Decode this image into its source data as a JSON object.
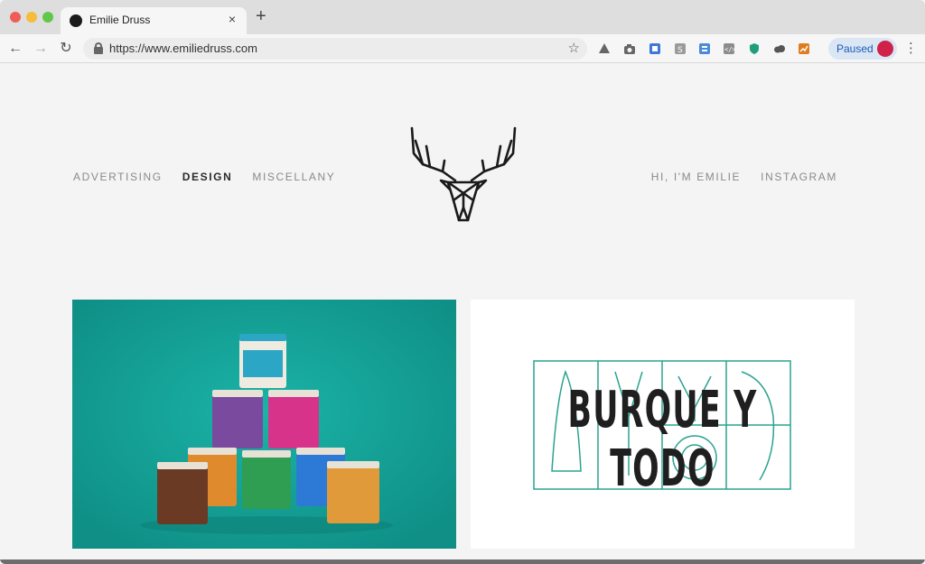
{
  "browser": {
    "tab_title": "Emilie Druss",
    "url": "https://www.emiliedruss.com",
    "profile_status": "Paused",
    "new_tab_label": "+",
    "close_label": "×",
    "menu_label": "⋮",
    "icons": {
      "back": "←",
      "forward": "→",
      "reload": "↻",
      "star": "☆"
    },
    "extensions": [
      "drive-icon",
      "camera-icon",
      "extension-blue-icon",
      "extension-grey-icon",
      "extension-doc-icon",
      "code-icon",
      "shield-icon",
      "cloud-icon",
      "chart-icon"
    ]
  },
  "site": {
    "nav_left": [
      "ADVERTISING",
      "DESIGN",
      "MISCELLANY"
    ],
    "nav_active": "DESIGN",
    "nav_right": [
      "HI, I'M EMILIE",
      "INSTAGRAM"
    ],
    "projects": [
      {
        "name": "ice-cream-packaging",
        "tile_color": "#16a197"
      },
      {
        "name": "burque-y-todo",
        "title": "BURQUE Y TODO",
        "accent": "#2aa38f"
      }
    ]
  },
  "colors": {
    "teal": "#16a197",
    "accent_green": "#2aa38f",
    "paused_text": "#1a5bb5"
  }
}
